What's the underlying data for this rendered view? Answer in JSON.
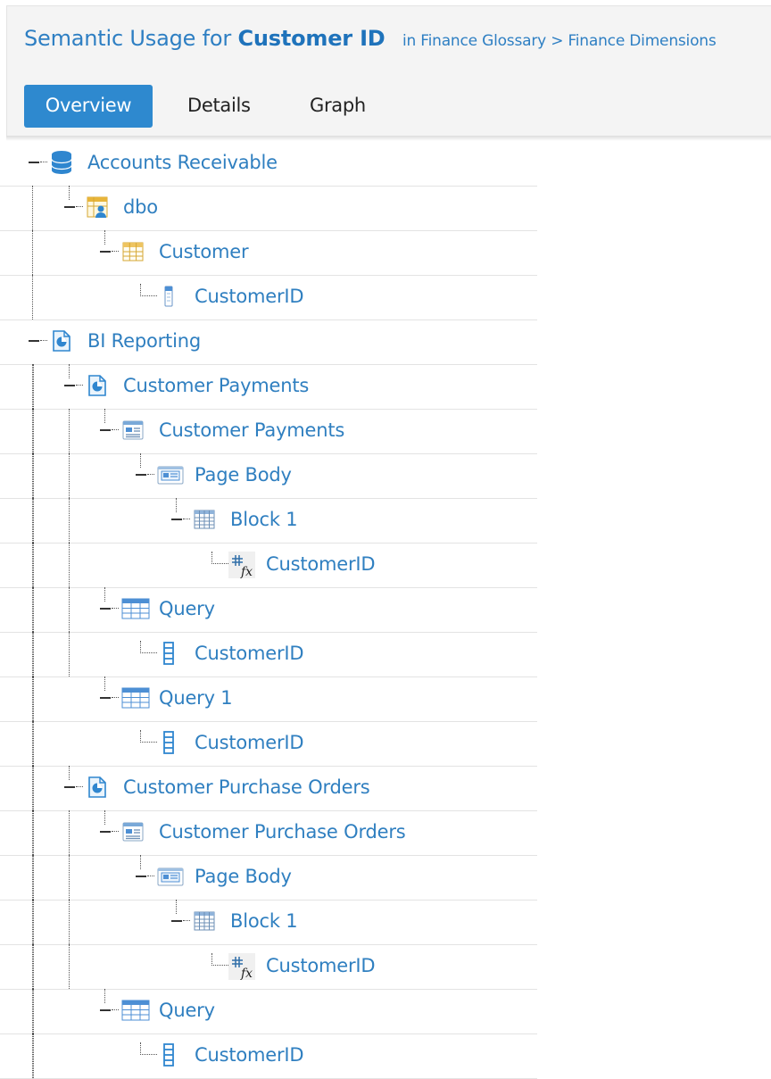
{
  "header": {
    "title_prefix": "Semantic Usage for",
    "entity_name": "Customer ID",
    "breadcrumb": "in Finance Glossary > Finance Dimensions"
  },
  "tabs": [
    {
      "label": "Overview",
      "active": true
    },
    {
      "label": "Details",
      "active": false
    },
    {
      "label": "Graph",
      "active": false
    }
  ],
  "tree": [
    {
      "label": "Accounts Receivable",
      "depth": 0,
      "icon": "database-icon",
      "expanded": true
    },
    {
      "label": "dbo",
      "depth": 1,
      "icon": "schema-icon",
      "expanded": true
    },
    {
      "label": "Customer",
      "depth": 2,
      "icon": "table-icon",
      "expanded": true
    },
    {
      "label": "CustomerID",
      "depth": 3,
      "icon": "column-icon",
      "expanded": false
    },
    {
      "label": "BI Reporting",
      "depth": 0,
      "icon": "report-folder-icon",
      "expanded": true
    },
    {
      "label": "Customer Payments",
      "depth": 1,
      "icon": "report-icon",
      "expanded": true
    },
    {
      "label": "Customer Payments",
      "depth": 2,
      "icon": "report-page-icon",
      "expanded": true
    },
    {
      "label": "Page Body",
      "depth": 3,
      "icon": "page-body-icon",
      "expanded": true
    },
    {
      "label": "Block 1",
      "depth": 4,
      "icon": "block-grid-icon",
      "expanded": true
    },
    {
      "label": "CustomerID",
      "depth": 5,
      "icon": "formula-field-icon",
      "expanded": false
    },
    {
      "label": "Query",
      "depth": 2,
      "icon": "query-grid-icon",
      "expanded": true
    },
    {
      "label": "CustomerID",
      "depth": 3,
      "icon": "query-column-icon",
      "expanded": false
    },
    {
      "label": "Query 1",
      "depth": 2,
      "icon": "query-grid-icon",
      "expanded": true
    },
    {
      "label": "CustomerID",
      "depth": 3,
      "icon": "query-column-icon",
      "expanded": false
    },
    {
      "label": "Customer Purchase Orders",
      "depth": 1,
      "icon": "report-icon",
      "expanded": true
    },
    {
      "label": "Customer Purchase Orders",
      "depth": 2,
      "icon": "report-page-icon",
      "expanded": true
    },
    {
      "label": "Page Body",
      "depth": 3,
      "icon": "page-body-icon",
      "expanded": true
    },
    {
      "label": "Block 1",
      "depth": 4,
      "icon": "block-grid-icon",
      "expanded": true
    },
    {
      "label": "CustomerID",
      "depth": 5,
      "icon": "formula-field-icon",
      "expanded": false
    },
    {
      "label": "Query",
      "depth": 2,
      "icon": "query-grid-icon",
      "expanded": true
    },
    {
      "label": "CustomerID",
      "depth": 3,
      "icon": "query-column-icon",
      "expanded": false
    }
  ],
  "colors": {
    "link": "#2f7fc0",
    "active_tab": "#2e89cf",
    "header_bg": "#f4f4f4"
  }
}
